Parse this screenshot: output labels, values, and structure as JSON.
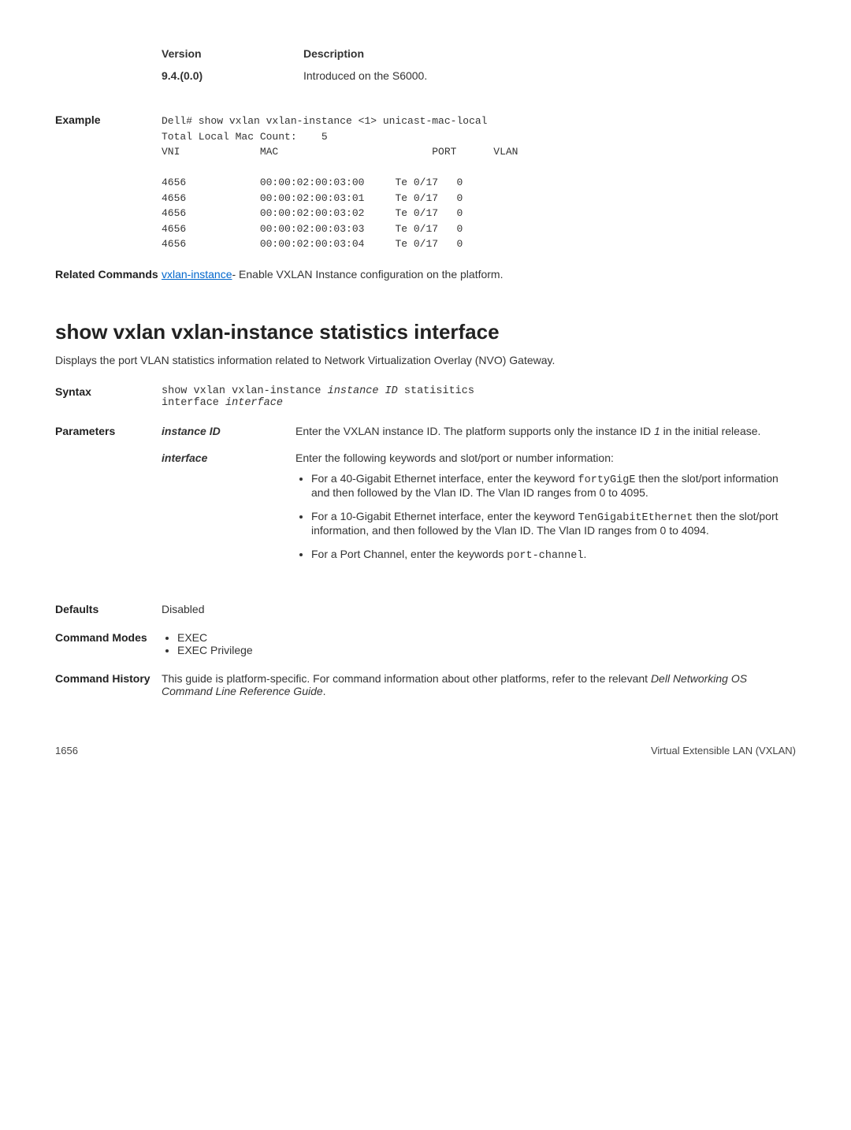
{
  "versionBlock": {
    "headerVersion": "Version",
    "headerDescription": "Description",
    "versionValue": "9.4.(0.0)",
    "versionDesc": "Introduced on the S6000."
  },
  "exampleLabel": "Example",
  "exampleCode": "Dell# show vxlan vxlan-instance <1> unicast-mac-local\nTotal Local Mac Count:    5\nVNI             MAC                         PORT      VLAN\n\n4656            00:00:02:00:03:00     Te 0/17   0\n4656            00:00:02:00:03:01     Te 0/17   0\n4656            00:00:02:00:03:02     Te 0/17   0\n4656            00:00:02:00:03:03     Te 0/17   0\n4656            00:00:02:00:03:04     Te 0/17   0",
  "relatedLabel": "Related Commands",
  "relatedLink": "vxlan-instance",
  "relatedText": "- Enable VXLAN Instance configuration on the platform.",
  "sectionTitle": "show vxlan vxlan-instance statistics interface",
  "sectionIntro": "Displays the port VLAN statistics information related to Network Virtualization Overlay (NVO) Gateway.",
  "syntaxLabel": "Syntax",
  "syntaxLine1": "show vxlan vxlan-instance ",
  "syntaxItalic1": "instance ID",
  "syntaxLine1b": " statisitics",
  "syntaxLine2a": "interface  ",
  "syntaxItalic2": "interface",
  "parametersLabel": "Parameters",
  "param1Name": "instance ID",
  "param1DescA": "Enter the VXLAN instance ID. The platform supports only the instance ID ",
  "param1DescItalic": "1",
  "param1DescB": " in the initial release.",
  "param2Name": "interface",
  "param2Intro": "Enter the following keywords and slot/port or number information:",
  "param2Bullet1a": "For a 40-Gigabit Ethernet interface, enter the keyword ",
  "param2Bullet1code": "fortyGigE",
  "param2Bullet1b": " then the slot/port information and then followed by the Vlan ID. The Vlan ID ranges from 0 to 4095.",
  "param2Bullet2a": "For a 10-Gigabit Ethernet interface, enter the keyword ",
  "param2Bullet2code": "TenGigabitEthernet",
  "param2Bullet2b": " then the slot/port information, and then followed by the Vlan ID. The Vlan ID ranges from 0 to 4094.",
  "param2Bullet3a": "For a Port Channel, enter the keywords ",
  "param2Bullet3code": "port-channel",
  "param2Bullet3b": ".",
  "defaultsLabel": "Defaults",
  "defaultsValue": "Disabled",
  "cmdModesLabel": "Command Modes",
  "cmdModesB1": "EXEC",
  "cmdModesB2": "EXEC Privilege",
  "cmdHistoryLabel": "Command History",
  "cmdHistoryTextA": "This guide is platform-specific. For command information about other platforms, refer to the relevant ",
  "cmdHistoryItalic": "Dell Networking OS Command Line Reference Guide",
  "cmdHistoryTextB": ".",
  "footerLeft": "1656",
  "footerRight": "Virtual Extensible LAN (VXLAN)"
}
